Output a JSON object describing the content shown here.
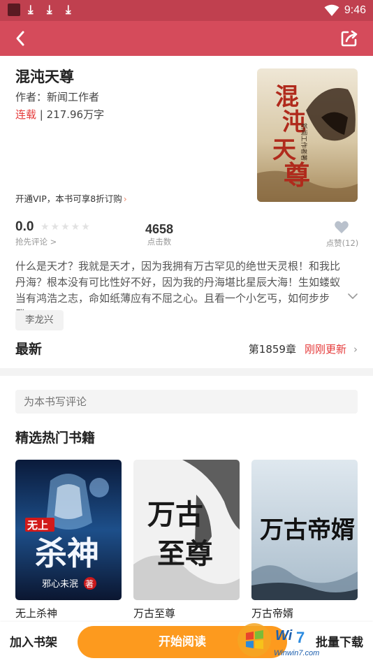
{
  "status_bar": {
    "time": "9:46",
    "download_glyph": "⤓"
  },
  "app_bar": {
    "back_icon": "back-arrow-icon",
    "share_icon": "share-icon"
  },
  "book": {
    "title": "混沌天尊",
    "author": "作者：新闻工作者",
    "status": "连载",
    "status_separator": " | ",
    "word_count": "217.96万字",
    "vip_text": "开通VIP，本书可享8折订购",
    "vip_arrow": "›",
    "cover_title": "混沌天尊",
    "cover_author": "新闻工作者著",
    "rating": "0.0",
    "stars": "★★★★★",
    "rate_link": "抢先评论 >",
    "click_count": "4658",
    "click_label": "点击数",
    "like_label": "点赞(12)",
    "description": "什么是天才？我就是天才，因为我拥有万古罕见的绝世天灵根！和我比丹海？根本没有可比性好不好，因为我的丹海堪比星辰大海！生如蝼蚁当有鸿浩之志，命如纸薄应有不屈之心。且看一个小乞丐，如何步步登...",
    "tag": "李龙兴"
  },
  "latest": {
    "label": "最新",
    "chapter": "第1859章",
    "update_status": "刚刚更新",
    "chevron": "›"
  },
  "comment": {
    "placeholder": "为本书写评论"
  },
  "hot_books": {
    "title": "精选热门书籍",
    "items": [
      {
        "name": "无上杀神",
        "cover_text": "杀神",
        "cover_badge": "无上",
        "cover_author": "邪心未泯",
        "cover_mark": "著"
      },
      {
        "name": "万古至尊",
        "cover_text": "万古至尊",
        "cover_author": ""
      },
      {
        "name": "万古帝婿",
        "cover_text": "万古帝婿",
        "cover_author": ""
      }
    ]
  },
  "bottom_bar": {
    "add_shelf": "加入书架",
    "start_read": "开始阅读",
    "batch_download": "批量下载"
  },
  "watermark": {
    "text": "Winwin7.com"
  },
  "colors": {
    "status_bar": "#c0404f",
    "app_bar": "#d54b5b",
    "accent_red": "#e53a3a",
    "start_read": "#fd9a1e"
  }
}
